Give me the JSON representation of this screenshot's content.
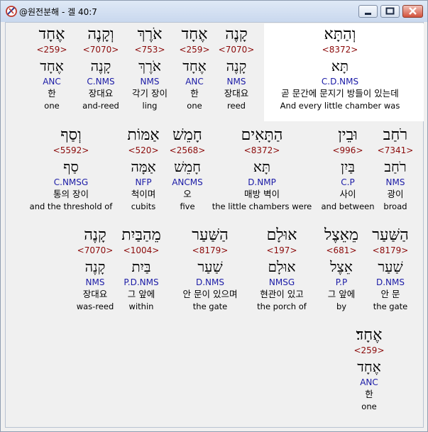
{
  "window": {
    "title": "@원전분해 - 겔 40:7"
  },
  "icons": {
    "app": "app-icon",
    "minimize": "minimize-icon",
    "maximize": "maximize-icon",
    "close": "close-icon"
  },
  "rows": [
    [
      {
        "heb": "וְהַתָּא",
        "strong": "<8372>",
        "lemma": "תָּא",
        "morph": "C.D.NMS",
        "kor": "곧 문간에 문지기 방들이 있는데",
        "eng": "And every little chamber was"
      },
      {
        "heb": "קָנֶה",
        "strong": "<7070>",
        "lemma": "קָנֶה",
        "morph": "NMS",
        "kor": "장대요",
        "eng": "reed"
      },
      {
        "heb": "אֶחָד",
        "strong": "<259>",
        "lemma": "אֶחָד",
        "morph": "ANC",
        "kor": "한",
        "eng": "one"
      },
      {
        "heb": "אֹרֶךְ",
        "strong": "<753>",
        "lemma": "אֹרֶךְ",
        "morph": "NMS",
        "kor": "각기 장이",
        "eng": "ling"
      },
      {
        "heb": "וְקָנֶה",
        "strong": "<7070>",
        "lemma": "קָנֶה",
        "morph": "C.NMS",
        "kor": "장대요",
        "eng": "and-reed"
      },
      {
        "heb": "אֶחָד",
        "strong": "<259>",
        "lemma": "אֶחָד",
        "morph": "ANC",
        "kor": "한",
        "eng": "one"
      }
    ],
    [
      {
        "heb": "רֹחַב",
        "strong": "<7341>",
        "lemma": "רֹחַב",
        "morph": "NMS",
        "kor": "광이",
        "eng": "broad"
      },
      {
        "heb": "וּבֵין",
        "strong": "<996>",
        "lemma": "בַּיִן",
        "morph": "C.P",
        "kor": "사이",
        "eng": "and between"
      },
      {
        "heb": "הַתָּאִים",
        "strong": "<8372>",
        "lemma": "תָּא",
        "morph": "D.NMP",
        "kor": "매방 벽이",
        "eng": "the little chambers were"
      },
      {
        "heb": "חָמֵשׁ",
        "strong": "<2568>",
        "lemma": "חָמֵשׁ",
        "morph": "ANCMS",
        "kor": "오",
        "eng": "five"
      },
      {
        "heb": "אַמּוֹת",
        "strong": "<520>",
        "lemma": "אַמָּה",
        "morph": "NFP",
        "kor": "척이며",
        "eng": "cubits"
      },
      {
        "heb": "וְסַף",
        "strong": "<5592>",
        "lemma": "סַף",
        "morph": "C.NMSG",
        "kor": "통의 장이",
        "eng": "and the threshold of"
      }
    ],
    [
      {
        "heb": "הַשַּׁעַר",
        "strong": "<8179>",
        "lemma": "שַׁעַר",
        "morph": "D.NMS",
        "kor": "안 문",
        "eng": "the gate"
      },
      {
        "heb": "מֵאֵצֶל",
        "strong": "<681>",
        "lemma": "אֵצֶל",
        "morph": "P.P",
        "kor": "그 앞에",
        "eng": "by"
      },
      {
        "heb": "אוּלָם",
        "strong": "<197>",
        "lemma": "אוּלָם",
        "morph": "NMSG",
        "kor": "현관이 있고",
        "eng": "the porch of"
      },
      {
        "heb": "הַשַּׁעַר",
        "strong": "<8179>",
        "lemma": "שַׁעַר",
        "morph": "D.NMS",
        "kor": "안 문이 있으며",
        "eng": "the gate"
      },
      {
        "heb": "מֵהַבַּיִת",
        "strong": "<1004>",
        "lemma": "בַּיִת",
        "morph": "P.D.NMS",
        "kor": "그 앞에",
        "eng": "within"
      },
      {
        "heb": "קָנֶה",
        "strong": "<7070>",
        "lemma": "קָנֶה",
        "morph": "NMS",
        "kor": "장대요",
        "eng": "was-reed"
      }
    ],
    [
      {
        "heb": "אֶחָד׃",
        "strong": "<259>",
        "lemma": "אֶחָד",
        "morph": "ANC",
        "kor": "한",
        "eng": "one"
      }
    ]
  ]
}
